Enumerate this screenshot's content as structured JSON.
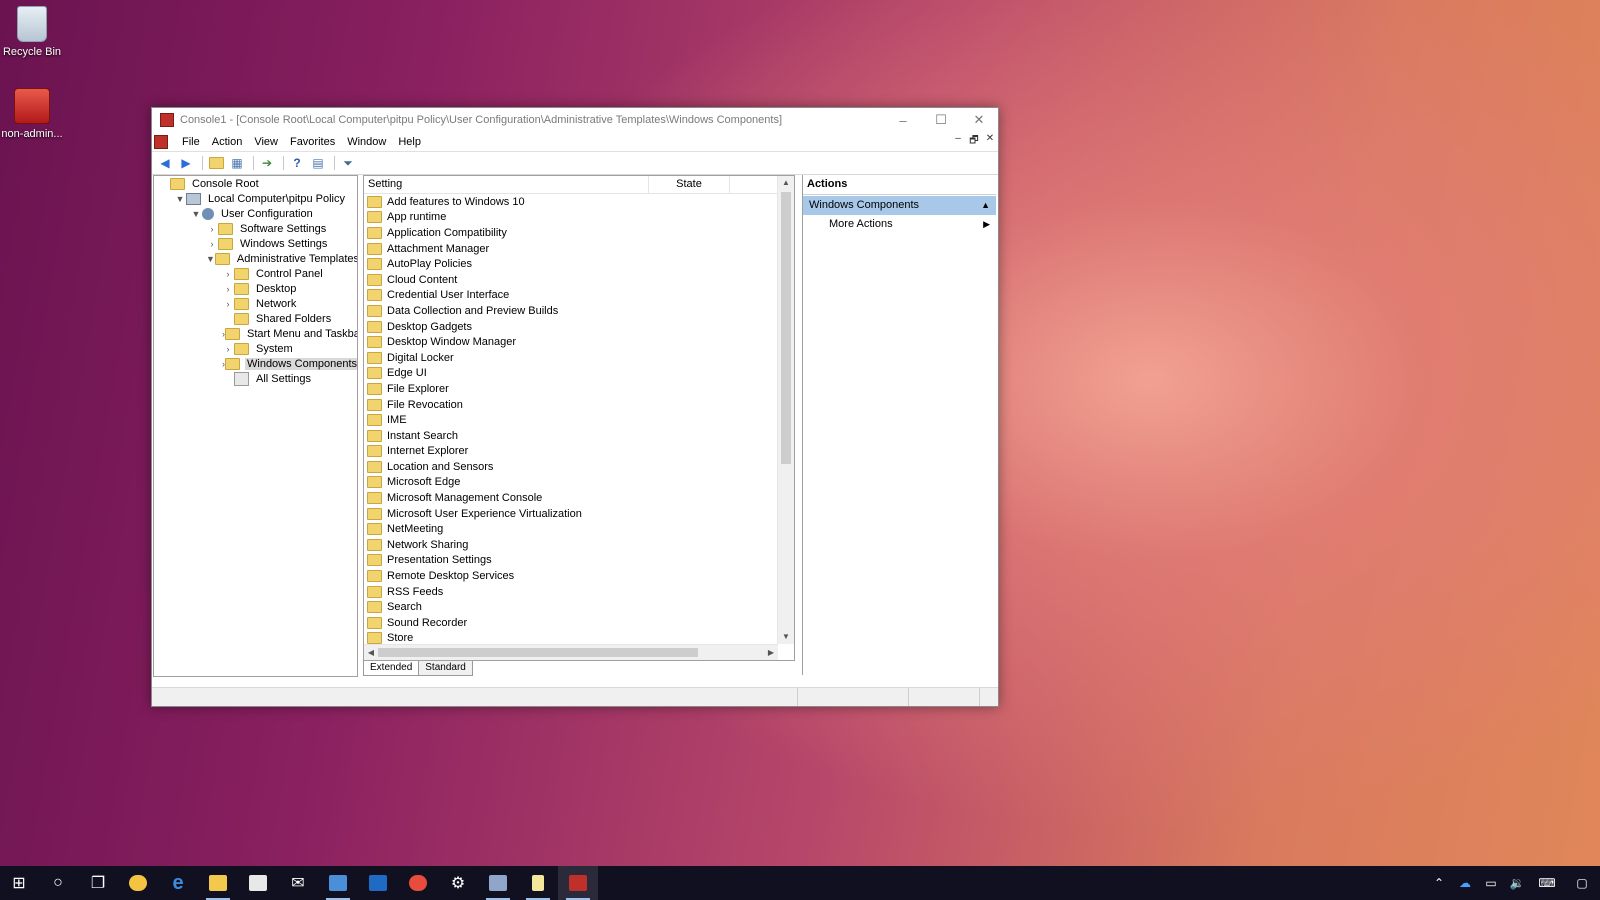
{
  "desktop": {
    "icons": [
      {
        "label": "Recycle Bin"
      },
      {
        "label": "non-admin..."
      }
    ]
  },
  "window": {
    "title": "Console1 - [Console Root\\Local Computer\\pitpu Policy\\User Configuration\\Administrative Templates\\Windows Components]",
    "controls": {
      "minimize": "–",
      "maximize": "☐",
      "close": "✕"
    },
    "menu": [
      "File",
      "Action",
      "View",
      "Favorites",
      "Window",
      "Help"
    ],
    "mdi_controls": {
      "minimize": "–",
      "restore": "🗗",
      "close": "✕"
    }
  },
  "tree": {
    "items": [
      {
        "label": "Console Root",
        "indent": 0,
        "expander": "",
        "icon": "folder"
      },
      {
        "label": "Local Computer\\pitpu Policy",
        "indent": 1,
        "expander": "▼",
        "icon": "pc"
      },
      {
        "label": "User Configuration",
        "indent": 2,
        "expander": "▼",
        "icon": "user"
      },
      {
        "label": "Software Settings",
        "indent": 3,
        "expander": "›",
        "icon": "folder"
      },
      {
        "label": "Windows Settings",
        "indent": 3,
        "expander": "›",
        "icon": "folder"
      },
      {
        "label": "Administrative Templates",
        "indent": 3,
        "expander": "▼",
        "icon": "folder"
      },
      {
        "label": "Control Panel",
        "indent": 4,
        "expander": "›",
        "icon": "folder"
      },
      {
        "label": "Desktop",
        "indent": 4,
        "expander": "›",
        "icon": "folder"
      },
      {
        "label": "Network",
        "indent": 4,
        "expander": "›",
        "icon": "folder"
      },
      {
        "label": "Shared Folders",
        "indent": 4,
        "expander": "",
        "icon": "folder"
      },
      {
        "label": "Start Menu and Taskbar",
        "indent": 4,
        "expander": "›",
        "icon": "folder"
      },
      {
        "label": "System",
        "indent": 4,
        "expander": "›",
        "icon": "folder"
      },
      {
        "label": "Windows Components",
        "indent": 4,
        "expander": "›",
        "icon": "folder",
        "selected": true
      },
      {
        "label": "All Settings",
        "indent": 4,
        "expander": "",
        "icon": "settings"
      }
    ]
  },
  "list": {
    "columns": {
      "setting": "Setting",
      "state": "State"
    },
    "rows": [
      "Add features to Windows 10",
      "App runtime",
      "Application Compatibility",
      "Attachment Manager",
      "AutoPlay Policies",
      "Cloud Content",
      "Credential User Interface",
      "Data Collection and Preview Builds",
      "Desktop Gadgets",
      "Desktop Window Manager",
      "Digital Locker",
      "Edge UI",
      "File Explorer",
      "File Revocation",
      "IME",
      "Instant Search",
      "Internet Explorer",
      "Location and Sensors",
      "Microsoft Edge",
      "Microsoft Management Console",
      "Microsoft User Experience Virtualization",
      "NetMeeting",
      "Network Sharing",
      "Presentation Settings",
      "Remote Desktop Services",
      "RSS Feeds",
      "Search",
      "Sound Recorder",
      "Store"
    ],
    "tabs": [
      "Extended",
      "Standard"
    ]
  },
  "actions": {
    "title": "Actions",
    "section": "Windows Components",
    "items": [
      "More Actions"
    ]
  },
  "colors": {
    "selection": "#a8c8ea",
    "folder": "#f2d46f",
    "taskbar": "#101020"
  }
}
